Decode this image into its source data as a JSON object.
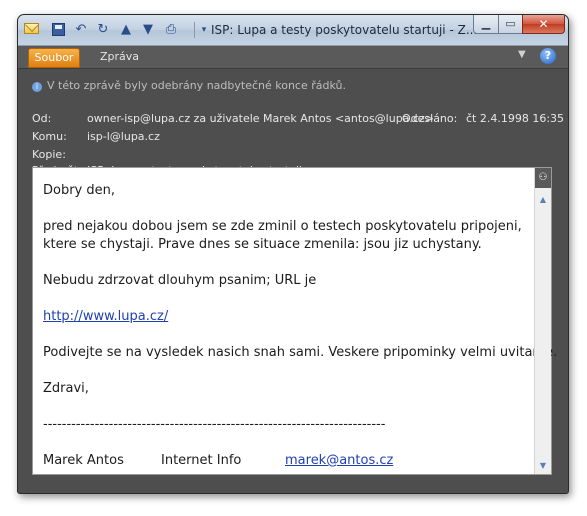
{
  "window": {
    "title": "ISP: Lupa a testy poskytovatelu startuji  -  Z..."
  },
  "ribbon": {
    "file_tab": "Soubor",
    "message_tab": "Zpráva"
  },
  "header": {
    "info_notice": "V této zprávě byly odebrány nadbytečné konce řádků.",
    "from_label": "Od:",
    "from_value": "owner-isp@lupa.cz za uživatele Marek Antos <antos@lupa.cz>",
    "sent_label": "Odesláno:",
    "sent_value": "čt 2.4.1998 16:35",
    "to_label": "Komu:",
    "to_value": "isp-l@lupa.cz",
    "cc_label": "Kopie:",
    "cc_value": "",
    "subject_label": "Předmět:",
    "subject_value": "ISP: Lupa a testy poskytovatelu startuji"
  },
  "message": {
    "greeting": "Dobry den,",
    "para1_line1": "pred nejakou dobou jsem se zde zminil o testech poskytovatelu pripojeni,",
    "para1_line2": "ktere se chystaji. Prave dnes se situace zmenila: jsou jiz uchystany.",
    "para2": "Nebudu zdrzovat dlouhym psanim; URL je",
    "link": "http://www.lupa.cz/",
    "para3": "Podivejte se na vysledek nasich snah sami. Veskere pripominky velmi uvitame.",
    "closing": "Zdravi,",
    "separator": "-------------------------------------------------------------------------",
    "sig_name": "Marek Antos",
    "sig_company": "Internet Info",
    "sig_email": "marek@antos.cz"
  }
}
